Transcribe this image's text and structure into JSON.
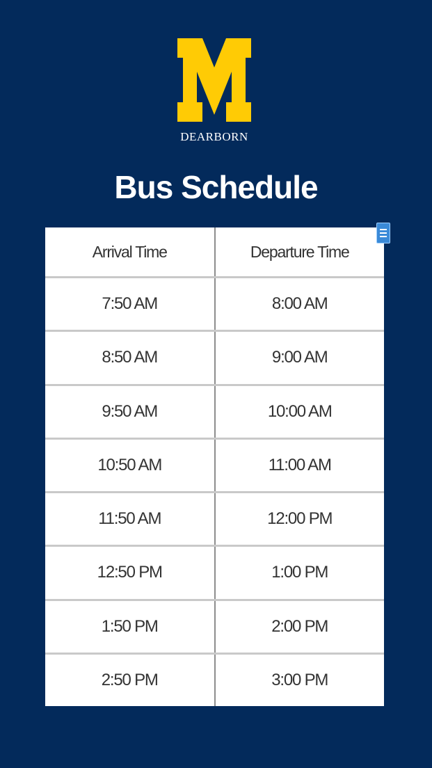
{
  "logo": {
    "icon": "block-m-logo",
    "text": "DEARBORN",
    "colors": {
      "m": "#ffcb05",
      "background": "#032a5b"
    }
  },
  "title": "Bus Schedule",
  "table": {
    "headers": [
      "Arrival Time",
      "Departure Time"
    ],
    "rows": [
      [
        "7:50 AM",
        "8:00 AM"
      ],
      [
        "8:50 AM",
        "9:00 AM"
      ],
      [
        "9:50 AM",
        "10:00 AM"
      ],
      [
        "10:50 AM",
        "11:00 AM"
      ],
      [
        "11:50 AM",
        "12:00 PM"
      ],
      [
        "12:50 PM",
        "1:00 PM"
      ],
      [
        "1:50 PM",
        "2:00 PM"
      ],
      [
        "2:50 PM",
        "3:00 PM"
      ]
    ]
  },
  "corner_icon": "table-menu-icon"
}
